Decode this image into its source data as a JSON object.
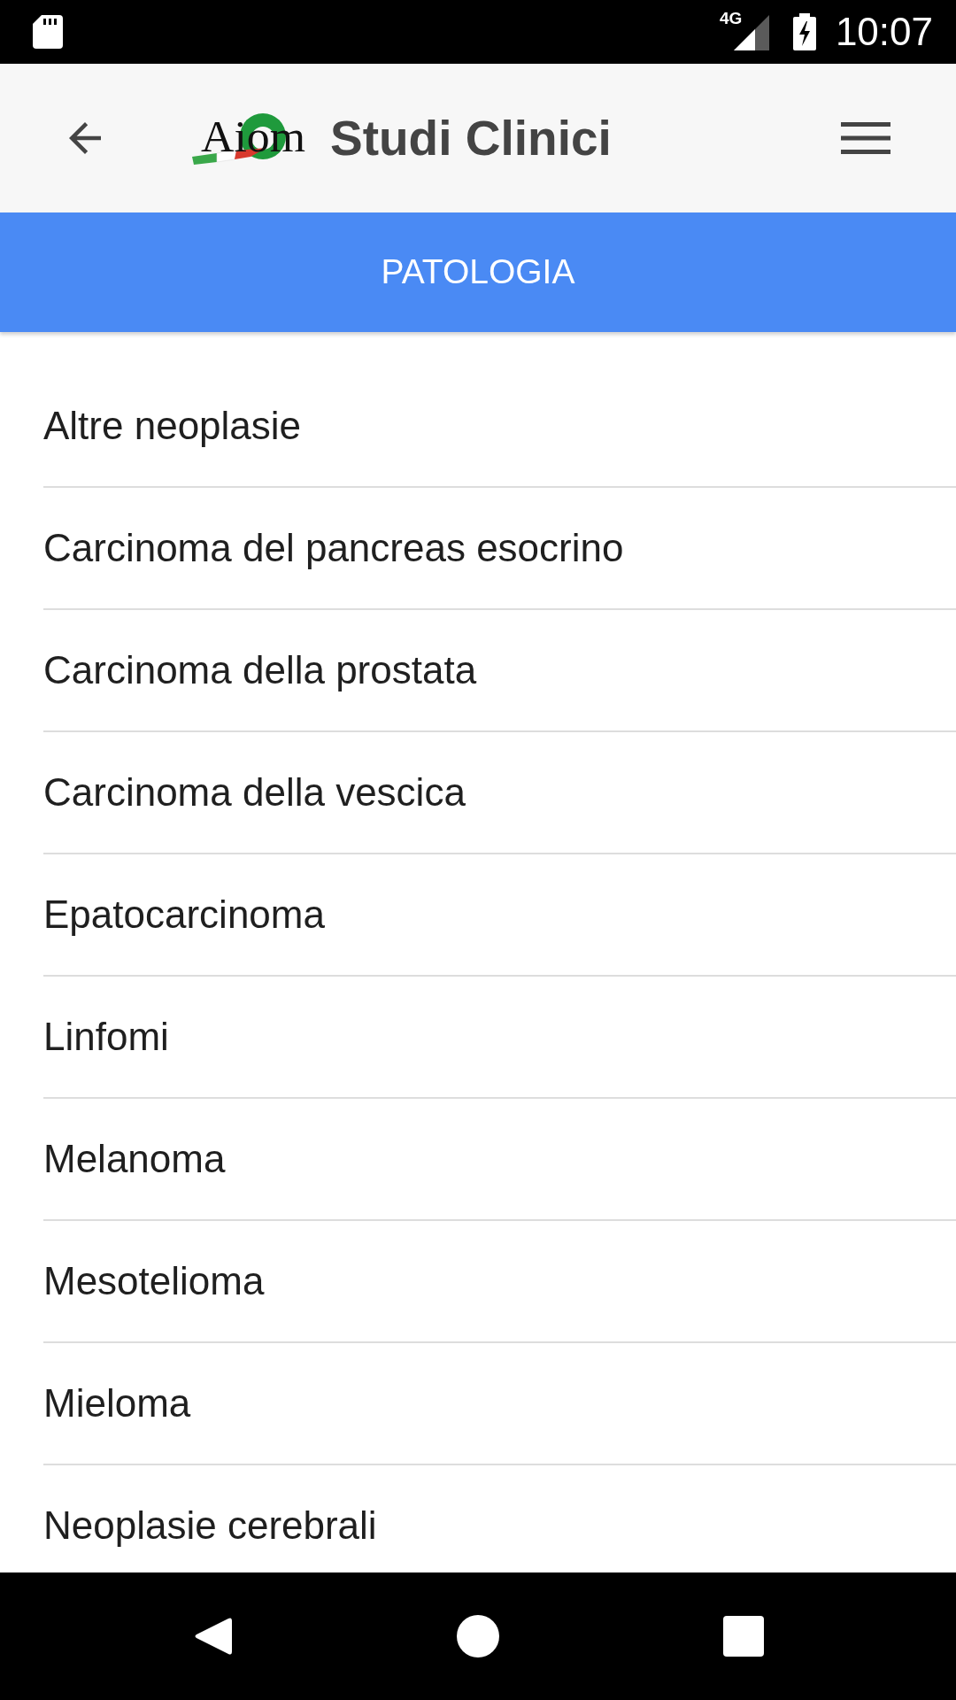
{
  "status_bar": {
    "network": "4G",
    "time": "10:07"
  },
  "header": {
    "logo_text": "Aiom",
    "title": "Studi Clinici"
  },
  "section_header": {
    "label": "PATOLOGIA"
  },
  "list": {
    "items": [
      {
        "label": "Altre neoplasie"
      },
      {
        "label": "Carcinoma del pancreas esocrino"
      },
      {
        "label": "Carcinoma della prostata"
      },
      {
        "label": "Carcinoma della vescica"
      },
      {
        "label": "Epatocarcinoma"
      },
      {
        "label": "Linfomi"
      },
      {
        "label": "Melanoma"
      },
      {
        "label": "Mesotelioma"
      },
      {
        "label": "Mieloma"
      },
      {
        "label": "Neoplasie cerebrali"
      }
    ]
  }
}
